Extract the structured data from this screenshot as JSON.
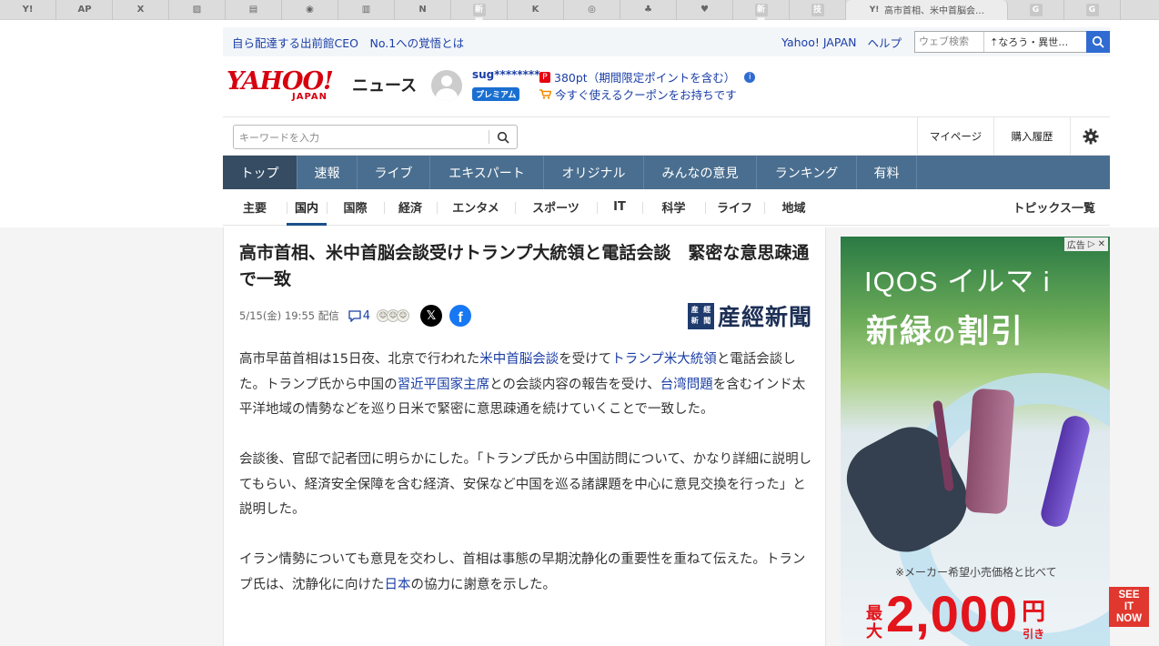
{
  "browser": {
    "tabs": [
      {
        "icon": "Y!"
      },
      {
        "icon": "AP"
      },
      {
        "icon": "X"
      },
      {
        "icon": "▨"
      },
      {
        "icon": "▤"
      },
      {
        "icon": "◉"
      },
      {
        "icon": "▥"
      },
      {
        "icon": "N"
      },
      {
        "icon": "新聞"
      },
      {
        "icon": "K"
      },
      {
        "icon": "◎"
      },
      {
        "icon": "♣"
      },
      {
        "icon": "♥"
      },
      {
        "icon": "新聞"
      },
      {
        "icon": "技"
      }
    ],
    "active_tab": {
      "icon": "Y!",
      "title": "高市首相、米中首脳会…"
    },
    "extra_tabs": [
      {
        "icon": "G"
      },
      {
        "icon": "G"
      }
    ]
  },
  "topbar": {
    "promo": "自ら配達する出前館CEO　No.1への覚悟とは",
    "yahoo_japan": "Yahoo! JAPAN",
    "help": "ヘルプ",
    "web_search_placeholder": "ウェブ検索",
    "suggestion": "なろう・異世…"
  },
  "brand": {
    "logo": "YAHOO!",
    "logo_sub": "JAPAN",
    "service": "ニュース"
  },
  "user": {
    "name": "sug********",
    "badge": "プレミアム",
    "points": "380pt（期間限定ポイントを含む）",
    "coupon": "今すぐ使えるクーポンをお持ちです"
  },
  "search": {
    "placeholder": "キーワードを入力",
    "mypage": "マイページ",
    "purchase_history": "購入履歴"
  },
  "nav": {
    "items": [
      "トップ",
      "速報",
      "ライブ",
      "エキスパート",
      "オリジナル",
      "みんなの意見",
      "ランキング",
      "有料"
    ],
    "active": "トップ"
  },
  "subnav": {
    "items": [
      "主要",
      "国内",
      "国際",
      "経済",
      "エンタメ",
      "スポーツ",
      "IT",
      "科学",
      "ライフ",
      "地域"
    ],
    "active": "国内",
    "topics": "トピックス一覧"
  },
  "article": {
    "title": "高市首相、米中首脳会談受けトランプ大統領と電話会談　緊密な意思疎通で一致",
    "datetime": "5/15(金) 19:55 配信",
    "comments": "4",
    "publisher": "産經新聞",
    "publisher_mark": [
      "産",
      "經",
      "新",
      "聞"
    ],
    "p1": {
      "t1": "高市早苗首相は15日夜、北京で行われた",
      "l1": "米中首脳会談",
      "t2": "を受けて",
      "l2": "トランプ米大統領",
      "t3": "と電話会談した。トランプ氏から中国の",
      "l3": "習近平国家主席",
      "t4": "との会談内容の報告を受け、",
      "l4": "台湾問題",
      "t5": "を含むインド太平洋地域の情勢などを巡り日米で緊密に意思疎通を続けていくことで一致した。"
    },
    "p2": "会談後、官邸で記者団に明らかにした。「トランプ氏から中国訪問について、かなり詳細に説明してもらい、経済安全保障を含む経済、安保など中国を巡る諸課題を中心に意見交換を行った」と説明した。",
    "p3": {
      "t1": "イラン情勢についても意見を交わし、首相は事態の早期沈静化の重要性を重ねて伝えた。トランプ氏は、沈静化に向けた",
      "l1": "日本",
      "t2": "の協力に謝意を示した。"
    }
  },
  "ad": {
    "label": "広告",
    "headline": "IQOS イルマ i",
    "sub_a": "新緑",
    "sub_b": "の",
    "sub_c": "割引",
    "note": "※メーカー希望小売価格と比べて",
    "max": "最大",
    "amount": "2,000",
    "yen": "円",
    "off": "引き",
    "see_it_now": [
      "SEE",
      "IT",
      "NOW"
    ]
  },
  "colors": {
    "nav_bg": "#4a6e8f",
    "nav_active": "#354c63",
    "link": "#1a3ea6",
    "yahoo_red": "#d7000f",
    "ad_red": "#e3141b"
  }
}
